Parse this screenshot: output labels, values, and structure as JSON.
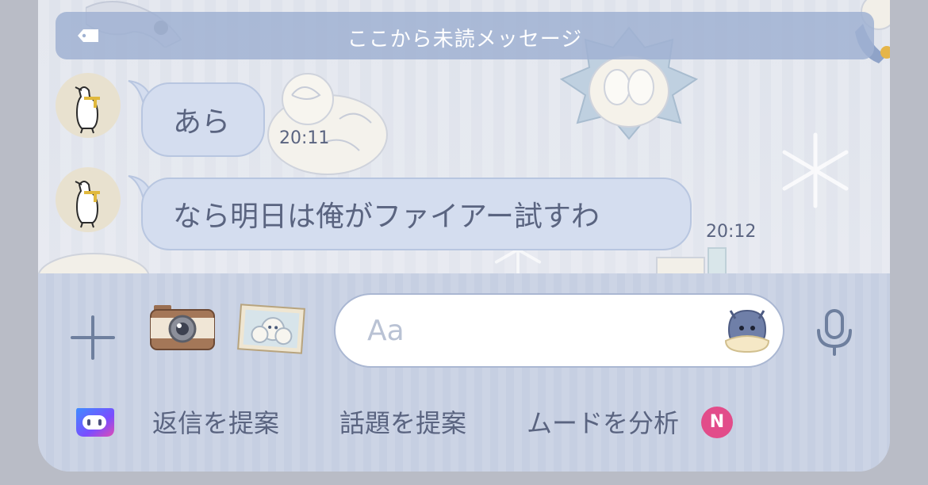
{
  "chat": {
    "unread_label": "ここから未読メッセージ",
    "messages": [
      {
        "text": "あら",
        "time": "20:11"
      },
      {
        "text": "なら明日は俺がファイアー試すわ",
        "time": "20:12"
      }
    ]
  },
  "input": {
    "placeholder": "Aa"
  },
  "suggestions": {
    "reply": "返信を提案",
    "topic": "話題を提案",
    "mood": "ムードを分析",
    "mood_badge": "N"
  },
  "icons": {
    "tag": "tag-icon",
    "plus": "plus-icon",
    "camera": "camera-icon",
    "album": "photo-album-icon",
    "sticker": "sticker-icon",
    "mic": "microphone-icon",
    "ai": "ai-assistant-icon"
  },
  "colors": {
    "bubble": "#d4ddef",
    "text": "#5a6480",
    "badge": "#e24c8a",
    "unread_bar": "#a0b2d2"
  }
}
